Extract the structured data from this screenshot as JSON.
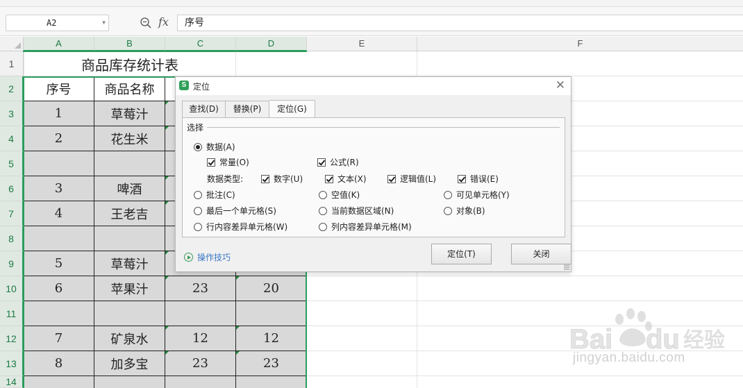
{
  "formula_bar": {
    "name_box": "A2",
    "fx_label": "fx",
    "formula_value": "序号"
  },
  "columns": [
    "A",
    "B",
    "C",
    "D",
    "E",
    "F"
  ],
  "rows": [
    "1",
    "2",
    "3",
    "4",
    "5",
    "6",
    "7",
    "8",
    "9",
    "10",
    "11",
    "12",
    "13",
    "14"
  ],
  "sheet": {
    "title": "商品库存统计表",
    "header": {
      "a": "序号",
      "b": "商品名称"
    },
    "cells": {
      "a3": "1",
      "b3": "草莓汁",
      "a4": "2",
      "b4": "花生米",
      "a6": "3",
      "b6": "啤酒",
      "a7": "4",
      "b7": "王老吉",
      "a9": "5",
      "b9": "草莓汁",
      "a10": "6",
      "b10": "苹果汁",
      "c10": "23",
      "d10": "20",
      "a12": "7",
      "b12": "矿泉水",
      "c12": "12",
      "d12": "12",
      "a13": "8",
      "b13": "加多宝",
      "c13": "23",
      "d13": "23"
    }
  },
  "dialog": {
    "logo": "S",
    "title": "定位",
    "close": "✕",
    "tabs": [
      "查找(D)",
      "替换(P)",
      "定位(G)"
    ],
    "active_tab": "定位(G)",
    "section": "选择",
    "options": {
      "data": "数据(A)",
      "constant": "常量(O)",
      "formula": "公式(R)",
      "data_type_label": "数据类型:",
      "number": "数字(U)",
      "text": "文本(X)",
      "logical": "逻辑值(L)",
      "error": "错误(E)",
      "comment": "批注(C)",
      "blank": "空值(K)",
      "visible": "可见单元格(Y)",
      "last_cell": "最后一个单元格(S)",
      "current_region": "当前数据区域(N)",
      "object": "对象(B)",
      "row_diff": "行内容差异单元格(W)",
      "col_diff": "列内容差异单元格(M)"
    },
    "selected_option": "数据(A)",
    "tips": "操作技巧",
    "locate_button": "定位(T)",
    "close_button": "关闭"
  },
  "watermark": {
    "text": "jingyan.baidu.com"
  },
  "colors": {
    "selection_green": "#2a9d5c",
    "cell_gray": "#d9d9d9",
    "logo_green": "#2fa05a",
    "link_blue": "#3b78c4"
  }
}
